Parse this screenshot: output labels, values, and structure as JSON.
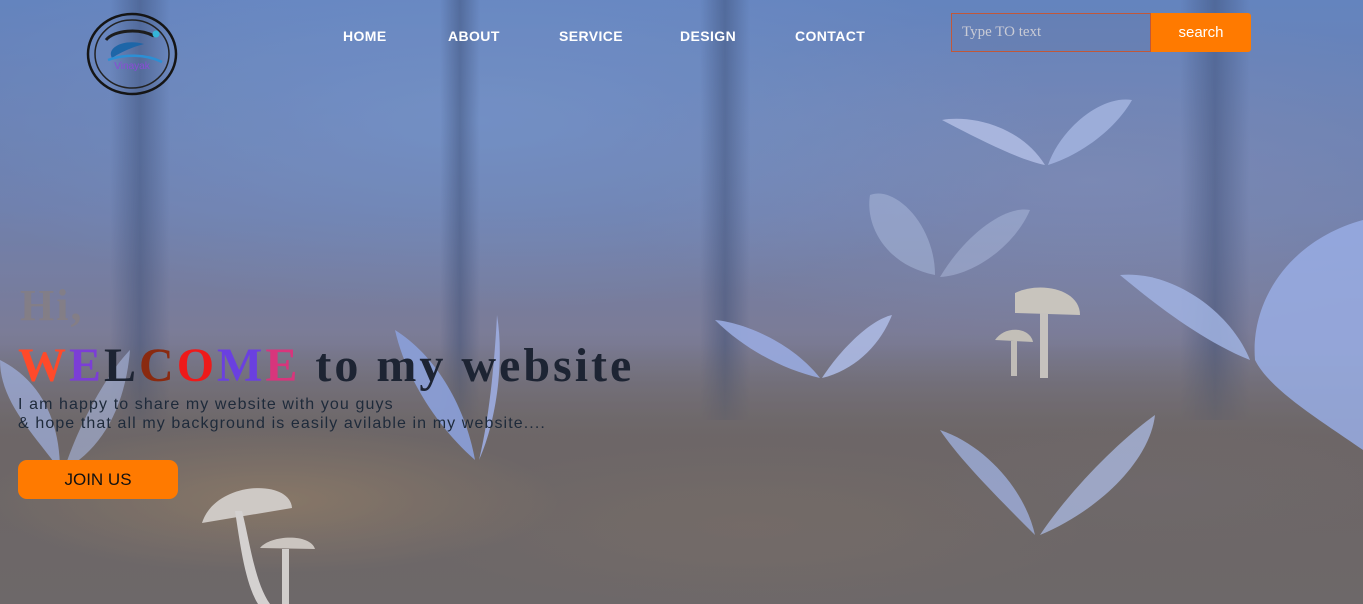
{
  "logo": {
    "text": "Vinayak",
    "icon": "swirl-logo-icon"
  },
  "nav": {
    "items": [
      "HOME",
      "ABOUT",
      "SERVICE",
      "DESIGN",
      "CONTACT"
    ]
  },
  "search": {
    "placeholder": "Type TO text",
    "button_label": "search"
  },
  "hero": {
    "greeting": "Hi,",
    "welcome_letters": [
      {
        "char": "W",
        "color": "#ff4a2a"
      },
      {
        "char": "E",
        "color": "#7b3ed6"
      },
      {
        "char": "L",
        "color": "#1d2433"
      },
      {
        "char": "C",
        "color": "#8a2a10"
      },
      {
        "char": "O",
        "color": "#ee1a1a"
      },
      {
        "char": "M",
        "color": "#6a40e0"
      },
      {
        "char": "E",
        "color": "#d8357c"
      }
    ],
    "welcome_rest": "to my website",
    "line1": "I am happy to share my website with you guys",
    "line2": "& hope that all my background is easily avilable in my website....",
    "join_label": "JOIN US"
  },
  "colors": {
    "accent": "#ff7a00"
  }
}
